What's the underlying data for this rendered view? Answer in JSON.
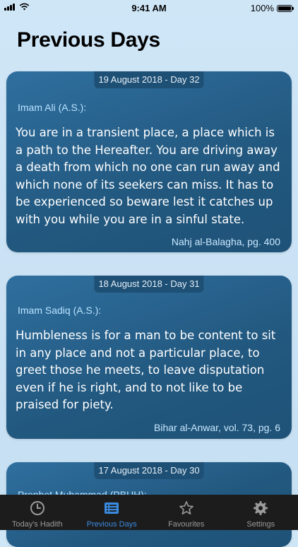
{
  "status_bar": {
    "time": "9:41 AM",
    "battery": "100%"
  },
  "page": {
    "title": "Previous Days"
  },
  "cards": [
    {
      "date": "19 August 2018 - Day 32",
      "author": "Imam Ali (A.S.):",
      "quote": "You are in a transient place, a place which is a path to the Hereafter. You are driving away a death from which no one can run away and which none of its seekers can miss. It has to be experienced so beware lest it catches up with you while you are in a sinful state.",
      "source": "Nahj al-Balagha, pg. 400"
    },
    {
      "date": "18 August 2018 - Day 31",
      "author": "Imam Sadiq (A.S.):",
      "quote": "Humbleness is for a man to be content to sit in any place and not a particular place, to greet those he meets, to leave disputation even if he is right, and to not like to be praised for piety.",
      "source": "Bihar al-Anwar, vol. 73, pg. 6"
    },
    {
      "date": "17 August 2018 - Day 30",
      "author": "Prophet Muhammad (PBUH):"
    }
  ],
  "tab_bar": {
    "tabs": [
      {
        "label": "Today's Hadith",
        "icon": "clock-icon"
      },
      {
        "label": "Previous Days",
        "icon": "list-icon",
        "active": true
      },
      {
        "label": "Favourites",
        "icon": "star-icon"
      },
      {
        "label": "Settings",
        "icon": "gear-icon"
      }
    ]
  },
  "colors": {
    "accent": "#3a8be0",
    "card": "#2a6592",
    "author": "#b8e3ff"
  }
}
